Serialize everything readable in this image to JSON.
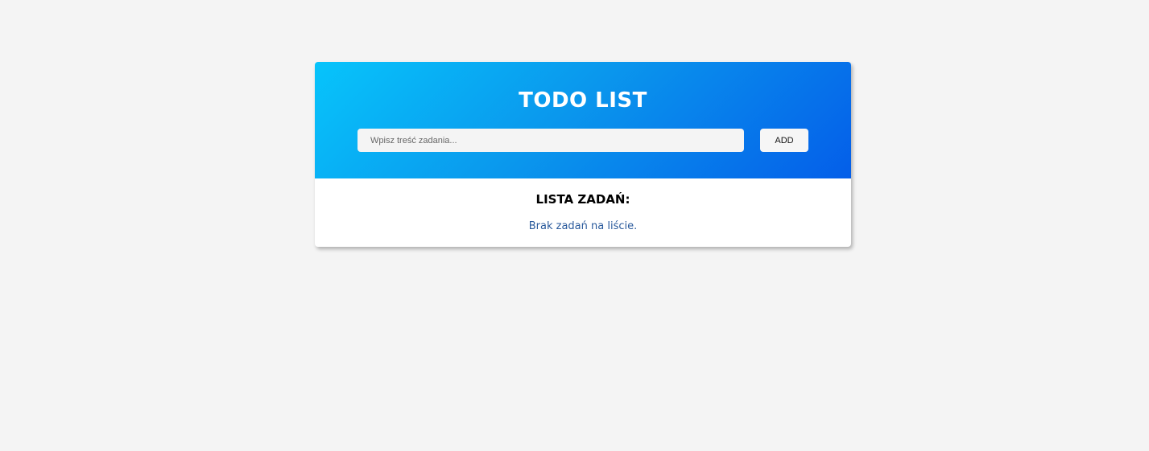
{
  "header": {
    "title": "TODO LIST"
  },
  "form": {
    "input_placeholder": "Wpisz treść zadania...",
    "input_value": "",
    "add_label": "ADD"
  },
  "list": {
    "heading": "LISTA ZADAŃ:",
    "empty_message": "Brak zadań na liście.",
    "items": []
  },
  "colors": {
    "page_background": "#f4f4f4",
    "gradient_start": "#07c4fb",
    "gradient_end": "#045ee9",
    "empty_message": "#2a5a9c"
  }
}
